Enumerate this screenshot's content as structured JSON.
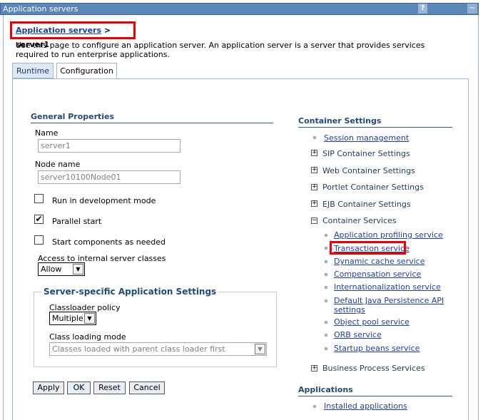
{
  "window": {
    "title": "Application servers",
    "help_glyph": "?",
    "minimize_glyph": "−"
  },
  "breadcrumb": {
    "parent": "Application servers",
    "separator": ">",
    "current": "server1"
  },
  "description": "Use this page to configure an application server. An application server is a server that provides services required to run enterprise applications.",
  "tabs": {
    "runtime": "Runtime",
    "configuration": "Configuration"
  },
  "general": {
    "heading": "General Properties",
    "name_label": "Name",
    "name_value": "server1",
    "node_label": "Node name",
    "node_value": "server10100Node01",
    "dev_mode_label": "Run in development mode",
    "dev_mode_checked": false,
    "parallel_label": "Parallel start",
    "parallel_checked": true,
    "start_components_label": "Start components as needed",
    "start_components_checked": false,
    "access_label": "Access to internal server classes",
    "access_value": "Allow"
  },
  "server_specific": {
    "heading": "Server-specific Application Settings",
    "classloader_policy_label": "Classloader policy",
    "classloader_policy_value": "Multiple",
    "class_loading_mode_label": "Class loading mode",
    "class_loading_mode_value": "Classes loaded with parent class loader first"
  },
  "buttons": {
    "apply": "Apply",
    "ok": "OK",
    "reset": "Reset",
    "cancel": "Cancel"
  },
  "container": {
    "heading": "Container Settings",
    "session_management": "Session management",
    "sip": "SIP Container Settings",
    "web": "Web Container Settings",
    "portlet": "Portlet Container Settings",
    "ejb": "EJB Container Settings",
    "services": "Container Services",
    "service_items": [
      "Application profiling service",
      "Transaction service",
      "Dynamic cache service",
      "Compensation service",
      "Internationalization service",
      "Default Java Persistence API settings",
      "Object pool service",
      "ORB service",
      "Startup beans service"
    ],
    "business_process": "Business Process Services"
  },
  "applications": {
    "heading": "Applications",
    "installed": "Installed applications"
  },
  "expander": {
    "plus": "+",
    "minus": "−"
  },
  "check_glyph": "✔",
  "arrow_glyph": "▼"
}
